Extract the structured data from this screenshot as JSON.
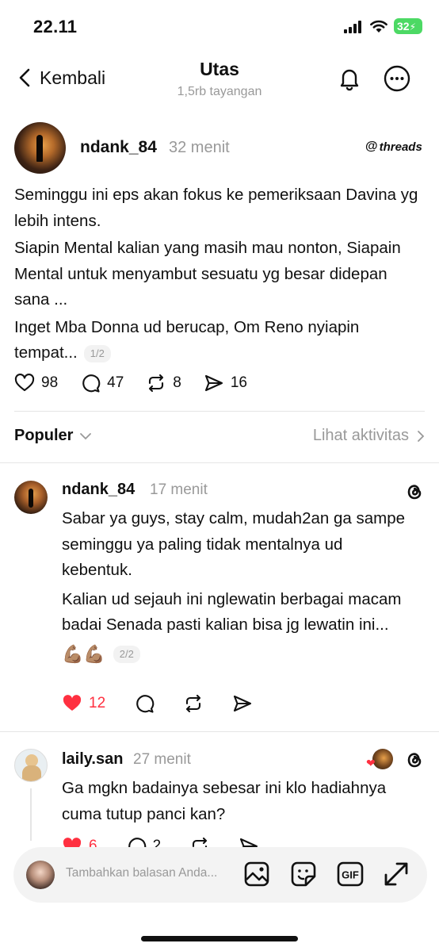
{
  "status_bar": {
    "time": "22.11",
    "battery": "32"
  },
  "header": {
    "back_label": "Kembali",
    "title": "Utas",
    "subtitle": "1,5rb tayangan"
  },
  "post": {
    "username": "ndank_84",
    "time": "32 menit",
    "brand": "threads",
    "paragraphs": [
      "Seminggu ini eps akan fokus ke pemeriksaan Davina yg lebih intens.",
      "Siapin Mental kalian yang masih mau nonton, Siapain Mental untuk menyambut sesuatu yg besar didepan sana ...",
      "Inget Mba Donna ud berucap, Om Reno nyiapin tempat..."
    ],
    "page": "1/2",
    "likes": "98",
    "comments": "47",
    "reposts": "8",
    "shares": "16"
  },
  "sort": {
    "label": "Populer",
    "activity": "Lihat aktivitas"
  },
  "replies": [
    {
      "username": "ndank_84",
      "time": "17 menit",
      "paragraphs": [
        "Sabar ya guys, stay calm, mudah2an ga sampe seminggu ya paling tidak mentalnya ud kebentuk.",
        "Kalian ud sejauh ini nglewatin berbagai macam badai Senada pasti kalian bisa jg lewatin ini..."
      ],
      "emoji": "💪🏽💪🏽",
      "page": "2/2",
      "likes": "12"
    },
    {
      "username": "laily.san",
      "time": "27 menit",
      "paragraphs": [
        "Ga mgkn badainya sebesar ini klo hadiahnya cuma tutup panci kan?"
      ],
      "likes": "6",
      "comments": "2"
    }
  ],
  "composer": {
    "placeholder": "Tambahkan balasan Anda..."
  },
  "colors": {
    "like_red": "#ff3040",
    "muted": "#999999",
    "text": "#101010"
  }
}
